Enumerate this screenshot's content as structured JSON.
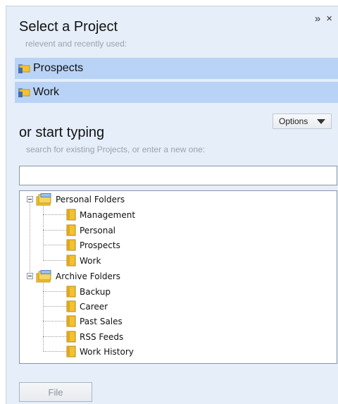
{
  "header": {
    "title": "Select a Project",
    "subtitle": "relevent and recently used:"
  },
  "window_controls": {
    "expand": "»",
    "close": "×"
  },
  "recent_projects": [
    {
      "label": "Prospects",
      "icon": "folder-icon"
    },
    {
      "label": "Work",
      "icon": "folder-icon"
    }
  ],
  "options": {
    "label": "Options"
  },
  "search": {
    "title": "or start typing",
    "subtitle": "search for existing Projects, or enter a new one:",
    "value": "",
    "placeholder": ""
  },
  "tree": {
    "groups": [
      {
        "label": "Personal Folders",
        "children": [
          "Management",
          "Personal",
          "Prospects",
          "Work"
        ]
      },
      {
        "label": "Archive Folders",
        "children": [
          "Backup",
          "Career",
          "Past Sales",
          "RSS Feeds",
          "Work History"
        ]
      }
    ]
  },
  "footer": {
    "file_label": "File"
  },
  "colors": {
    "panel_bg": "#e6eef9",
    "highlight": "#b9d3f6",
    "folder_yellow": "#f2c230",
    "hint_text": "#9aa3ad"
  }
}
